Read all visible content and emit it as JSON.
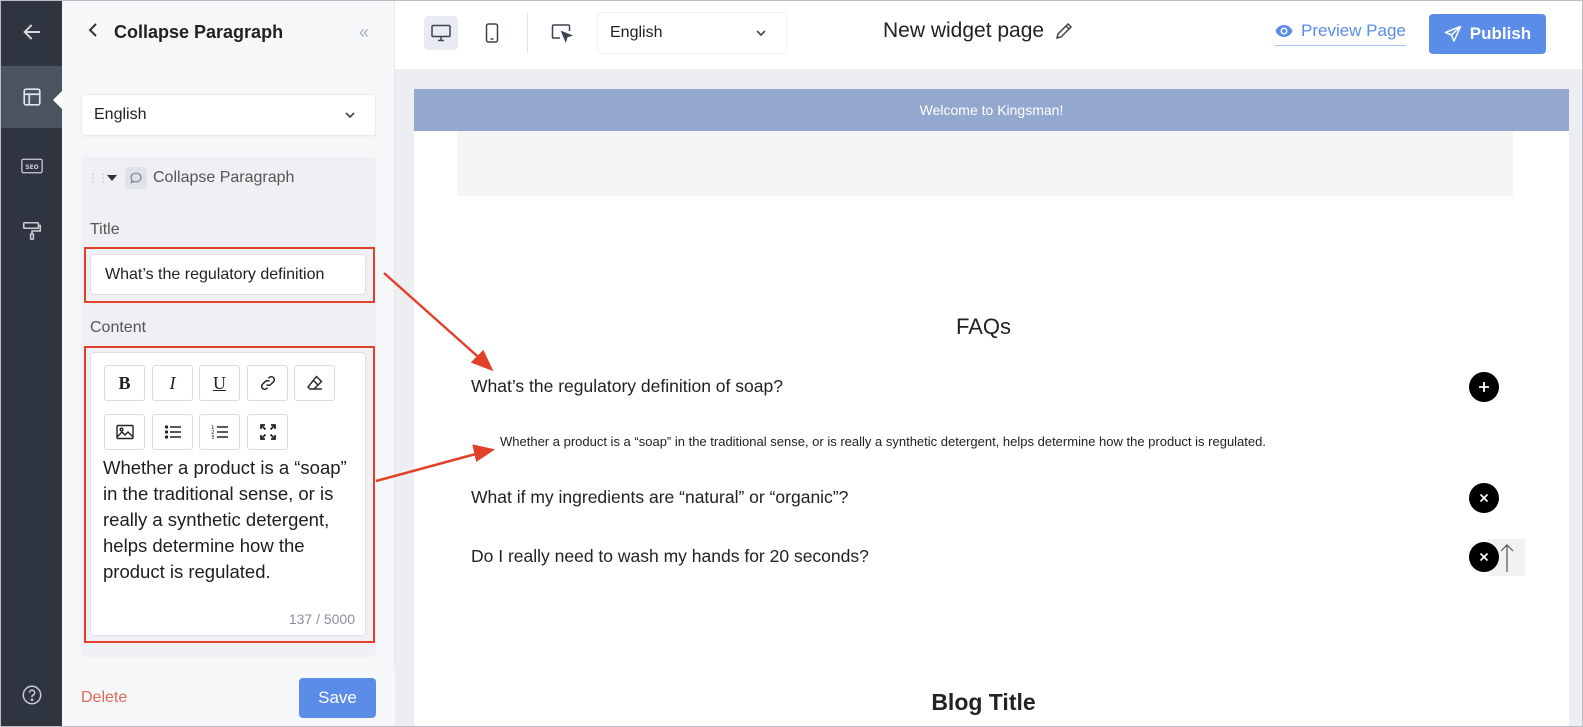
{
  "panel": {
    "back_icon": "chevron-left-icon",
    "title": "Collapse Paragraph",
    "collapse_icon": "double-chevron-left-icon",
    "language": "English",
    "block": {
      "name": "Collapse Paragraph",
      "title_label": "Title",
      "title_value": "What’s the regulatory definition",
      "content_label": "Content",
      "content_text": "Whether a product is a “soap” in the traditional sense, or is really a synthetic detergent, helps determine how the product is regulated.",
      "char_count": "137 / 5000",
      "toolbar": [
        "bold-icon",
        "italic-icon",
        "underline-icon",
        "link-icon",
        "eraser-icon",
        "image-icon",
        "bullet-list-icon",
        "numbered-list-icon",
        "fullscreen-icon"
      ]
    },
    "delete_label": "Delete",
    "save_label": "Save"
  },
  "rail": [
    "back-arrow-icon",
    "layout-icon",
    "seo-icon",
    "paint-roller-icon",
    "help-icon"
  ],
  "topbar": {
    "language": "English",
    "page_name": "New widget page",
    "preview_label": "Preview Page",
    "publish_label": "Publish"
  },
  "canvas": {
    "welcome": "Welcome to Kingsman!",
    "faq_title": "FAQs",
    "faqs": [
      {
        "q": "What’s the regulatory definition of soap?",
        "state": "collapsed"
      },
      {
        "q": "What if my ingredients are “natural” or “organic”?",
        "state": "expanded"
      },
      {
        "q": "Do I really need to wash my hands for 20 seconds?",
        "state": "expanded"
      }
    ],
    "answer": "Whether a product is a “soap” in the traditional sense, or is really a synthetic detergent, helps determine how the product is regulated.",
    "blog_title": "Blog Title"
  },
  "colors": {
    "accent": "#5b8de8",
    "highlight": "#e1412b",
    "rail": "#2f3540",
    "welcome_bar": "#93a7cf"
  }
}
